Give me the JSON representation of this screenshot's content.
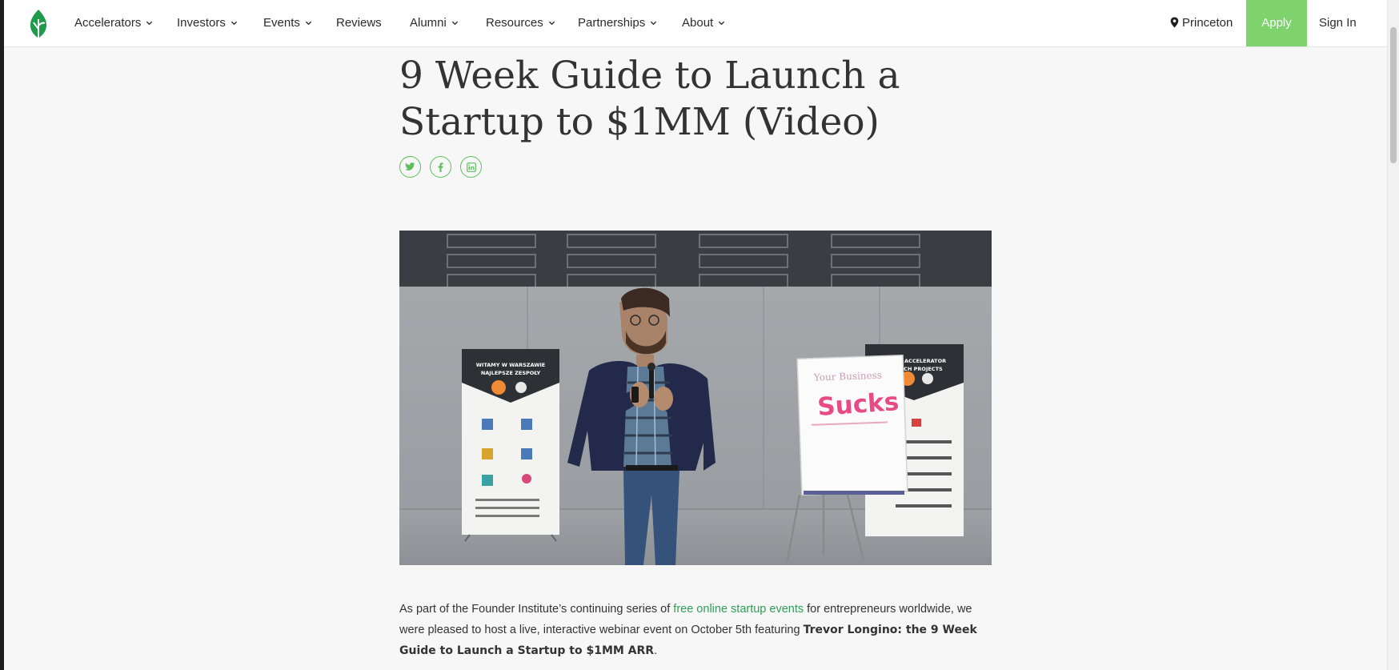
{
  "header": {
    "nav": [
      {
        "label": "Accelerators",
        "has_dropdown": true
      },
      {
        "label": "Investors",
        "has_dropdown": true
      },
      {
        "label": "Events",
        "has_dropdown": true
      },
      {
        "label": "Reviews",
        "has_dropdown": false
      },
      {
        "label": "Alumni",
        "has_dropdown": true
      },
      {
        "label": "Resources",
        "has_dropdown": true
      },
      {
        "label": "Partnerships",
        "has_dropdown": true
      },
      {
        "label": "About",
        "has_dropdown": true
      }
    ],
    "location": "Princeton",
    "apply_label": "Apply",
    "signin_label": "Sign In"
  },
  "article": {
    "title": "9 Week Guide to Launch a Startup to $1MM (Video)",
    "share_icons": [
      "twitter-icon",
      "facebook-icon",
      "linkedin-icon"
    ],
    "hero_image": {
      "banner_left_text": "WITAMY W WARSZAWIE NAJLEPSZE ZESPOŁY",
      "flipchart_header": "Your Business",
      "flipchart_word": "Sucks",
      "banner_right_text": "AW ACCELERATOR TECH PROJECTS"
    },
    "paragraph": {
      "part1": "As part of the Founder Institute’s continuing series of ",
      "link_text": "free online startup events",
      "part2": " for entrepreneurs worldwide, we were pleased to host a live, interactive webinar event on October 5th featuring ",
      "bold_text": "Trevor Longino: the 9 Week Guide to Launch a Startup to $1MM ARR",
      "part3": "."
    }
  },
  "colors": {
    "brand_green": "#7ed36c",
    "link_green": "#2f9e56",
    "icon_green": "#5cbf5c"
  }
}
